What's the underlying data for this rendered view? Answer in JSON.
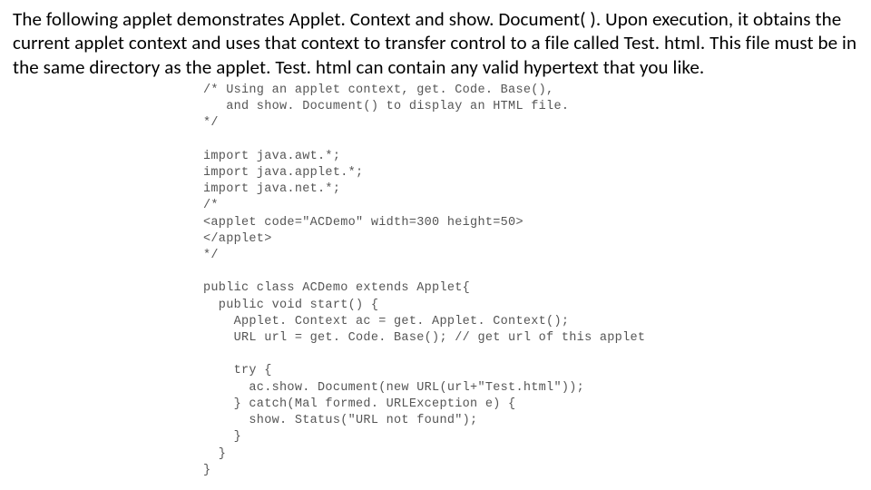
{
  "intro": "The following applet demonstrates Applet. Context and show. Document( ). Upon execution, it obtains the current applet context and uses that context to transfer control to a file called Test. html. This file must be in the same directory as the applet. Test. html can contain any valid hypertext that you like.",
  "code_lines": [
    "/* Using an applet context, get. Code. Base(),",
    "   and show. Document() to display an HTML file.",
    "*/",
    "",
    "import java.awt.*;",
    "import java.applet.*;",
    "import java.net.*;",
    "/*",
    "<applet code=\"ACDemo\" width=300 height=50>",
    "</applet>",
    "*/",
    "",
    "public class ACDemo extends Applet{",
    "  public void start() {",
    "    Applet. Context ac = get. Applet. Context();",
    "    URL url = get. Code. Base(); // get url of this applet",
    "",
    "    try {",
    "      ac.show. Document(new URL(url+\"Test.html\"));",
    "    } catch(Mal formed. URLException e) {",
    "      show. Status(\"URL not found\");",
    "    }",
    "  }",
    "}"
  ]
}
